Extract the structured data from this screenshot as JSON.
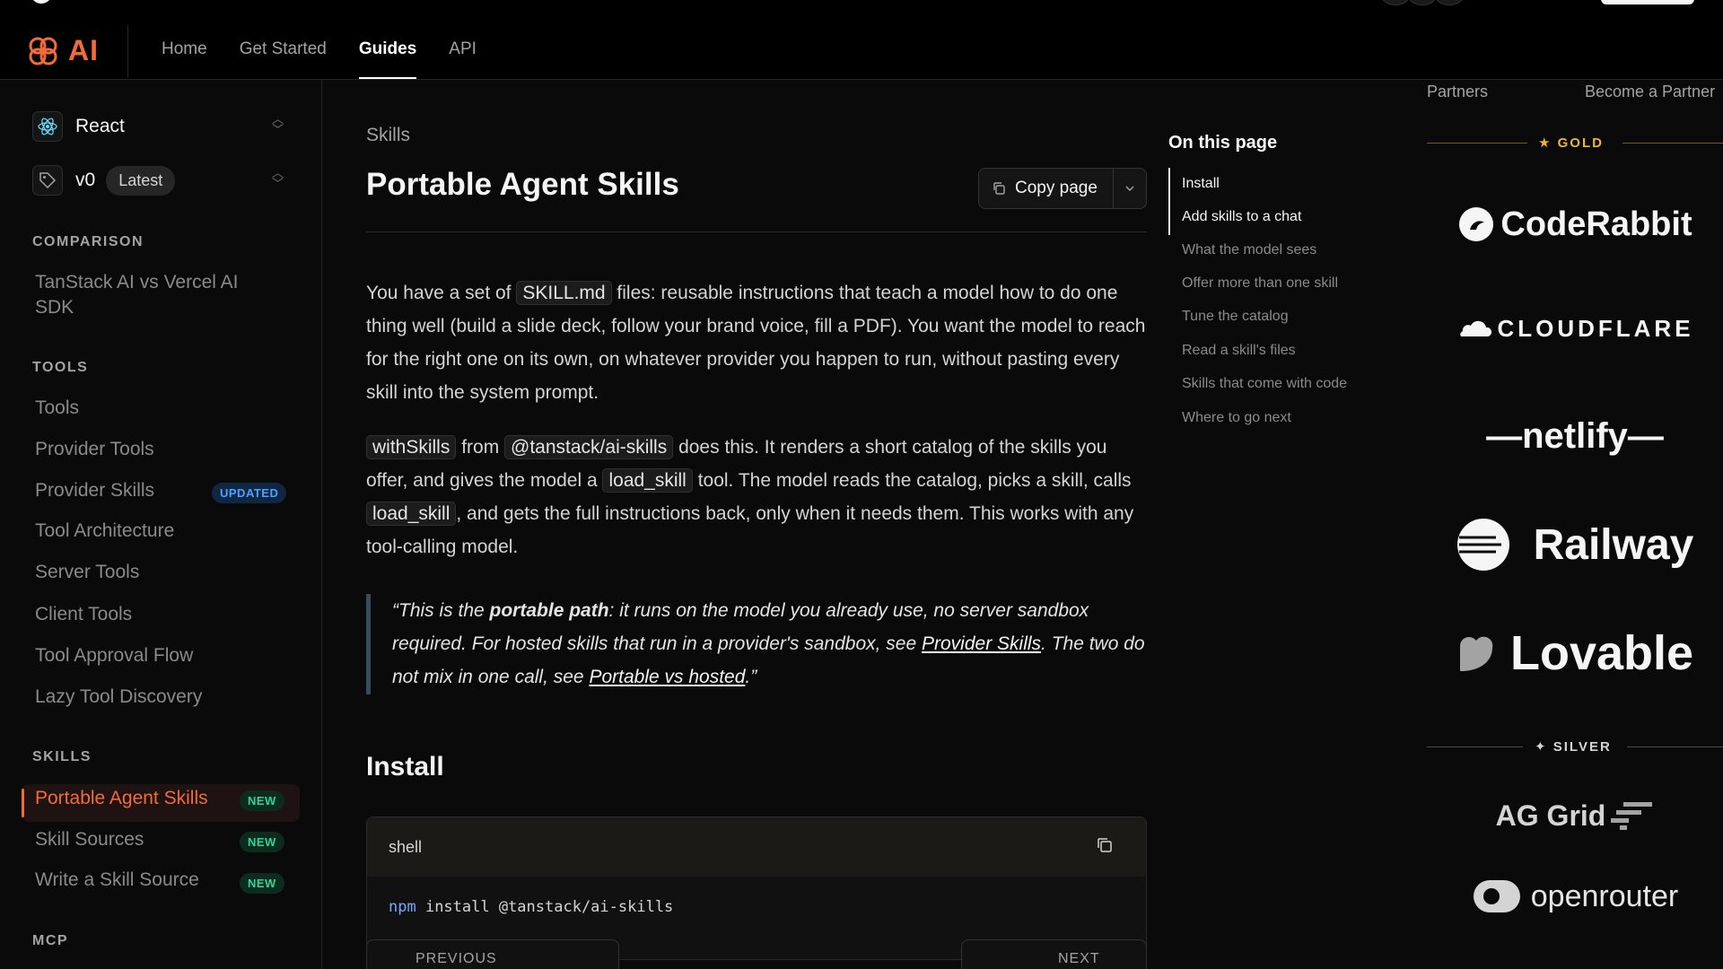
{
  "header": {
    "logo_text": "AI",
    "nav": [
      {
        "label": "Home",
        "active": false
      },
      {
        "label": "Get Started",
        "active": false
      },
      {
        "label": "Guides",
        "active": true
      },
      {
        "label": "API",
        "active": false
      }
    ]
  },
  "sidebar": {
    "framework": "React",
    "version": "v0",
    "version_badge": "Latest",
    "sections": {
      "comparison": {
        "title": "COMPARISON",
        "items": [
          "TanStack AI vs Vercel AI SDK"
        ]
      },
      "tools": {
        "title": "TOOLS",
        "items": [
          "Tools",
          "Provider Tools",
          "Provider Skills",
          "Tool Architecture",
          "Server Tools",
          "Client Tools",
          "Tool Approval Flow",
          "Lazy Tool Discovery"
        ],
        "provider_skills_badge": "UPDATED"
      },
      "skills": {
        "title": "SKILLS",
        "items": [
          "Portable Agent Skills",
          "Skill Sources",
          "Write a Skill Source"
        ],
        "badge": "NEW"
      },
      "mcp": {
        "title": "MCP"
      }
    }
  },
  "main": {
    "breadcrumb": "Skills",
    "title": "Portable Agent Skills",
    "copy_label": "Copy page",
    "p1": {
      "a": "You have a set of ",
      "code1": "SKILL.md",
      "b": " files: reusable instructions that teach a model how to do one thing well (build a slide deck, follow your brand voice, fill a PDF). You want the model to reach for the right one on its own, on whatever provider you happen to run, without pasting every skill into the system prompt."
    },
    "p2": {
      "code1": "withSkills",
      "a": " from ",
      "code2": "@tanstack/ai-skills",
      "b": " does this. It renders a short catalog of the skills you offer, and gives the model a ",
      "code3": "load_skill",
      "c": " tool. The model reads the catalog, picks a skill, calls ",
      "code4": "load_skill",
      "d": ", and gets the full instructions back, only when it needs them. This works with any tool-calling model."
    },
    "quote": {
      "a": "“This is the ",
      "strong": "portable path",
      "b": ": it runs on the model you already use, no server sandbox required. For hosted skills that run in a provider's sandbox, see ",
      "link1": "Provider Skills",
      "c": ". The two do not mix in one call, see ",
      "link2": "Portable vs hosted",
      "d": ".”"
    },
    "install_heading": "Install",
    "code_block": {
      "lang": "shell",
      "cmd": "npm",
      "args": " install @tanstack/ai-skills"
    },
    "pager": {
      "prev": "PREVIOUS",
      "next": "NEXT"
    }
  },
  "toc": {
    "title": "On this page",
    "items": [
      "Install",
      "Add skills to a chat",
      "What the model sees",
      "Offer more than one skill",
      "Tune the catalog",
      "Read a skill's files",
      "Skills that come with code",
      "Where to go next"
    ]
  },
  "partners": {
    "links": [
      "Partners",
      "Become a Partner"
    ],
    "gold_label": "GOLD",
    "gold": [
      "CodeRabbit",
      "CLOUDFLARE",
      "netlify",
      "Railway",
      "Lovable"
    ],
    "silver_label": "SILVER",
    "silver": [
      "AG Grid",
      "openrouter"
    ]
  },
  "colors": {
    "accent": "#f26b3a",
    "gold": "#e8b640",
    "new_badge": "#34d399",
    "updated_badge": "#4aa3ff"
  }
}
